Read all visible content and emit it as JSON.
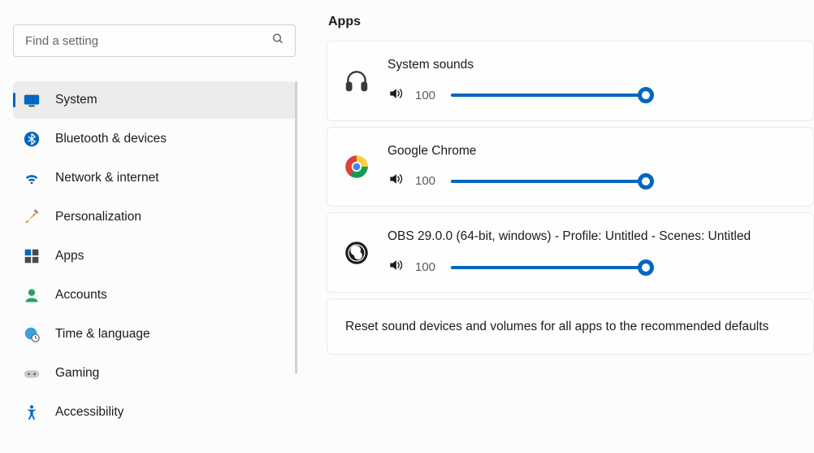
{
  "search": {
    "placeholder": "Find a setting"
  },
  "sidebar": {
    "items": [
      {
        "label": "System",
        "icon": "monitor",
        "selected": true
      },
      {
        "label": "Bluetooth & devices",
        "icon": "bluetooth"
      },
      {
        "label": "Network & internet",
        "icon": "wifi"
      },
      {
        "label": "Personalization",
        "icon": "brush"
      },
      {
        "label": "Apps",
        "icon": "apps"
      },
      {
        "label": "Accounts",
        "icon": "person"
      },
      {
        "label": "Time & language",
        "icon": "globe-clock"
      },
      {
        "label": "Gaming",
        "icon": "gamepad"
      },
      {
        "label": "Accessibility",
        "icon": "accessibility"
      }
    ]
  },
  "main": {
    "section_title": "Apps",
    "apps": [
      {
        "name": "System sounds",
        "icon": "headphones",
        "volume": 100
      },
      {
        "name": "Google Chrome",
        "icon": "chrome",
        "volume": 100
      },
      {
        "name": "OBS 29.0.0 (64-bit, windows) - Profile: Untitled - Scenes: Untitled",
        "icon": "obs",
        "volume": 100
      }
    ],
    "reset_text": "Reset sound devices and volumes for all apps to the recommended defaults"
  },
  "colors": {
    "accent": "#0067c0"
  }
}
